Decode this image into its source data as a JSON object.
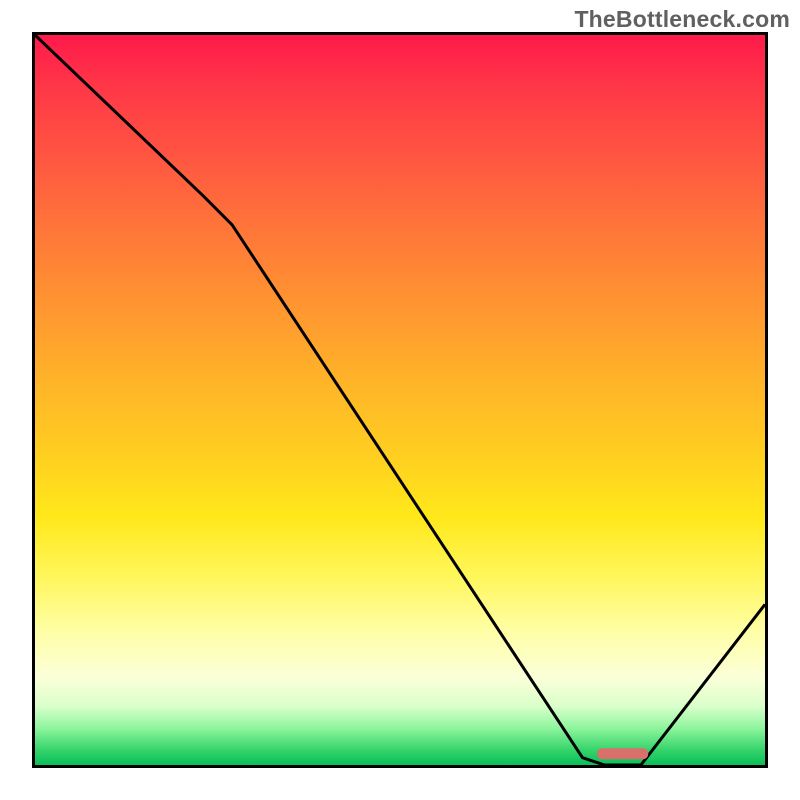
{
  "watermark": "TheBottleneck.com",
  "chart_data": {
    "type": "line",
    "title": "",
    "xlabel": "",
    "ylabel": "",
    "xlim": [
      0,
      100
    ],
    "ylim": [
      0,
      100
    ],
    "grid": false,
    "series": [
      {
        "name": "curve",
        "x": [
          0,
          23,
          27,
          75,
          78,
          83,
          100
        ],
        "y": [
          100,
          78,
          74,
          1,
          0,
          0,
          22
        ],
        "color": "#000000"
      }
    ],
    "marker": {
      "type": "rounded-bar",
      "x_range": [
        77,
        84
      ],
      "y": 0.8,
      "color": "#d9706a"
    },
    "background_gradient_stops": [
      {
        "pos": 0,
        "color": "#ff1a4b"
      },
      {
        "pos": 18,
        "color": "#ff5a40"
      },
      {
        "pos": 38,
        "color": "#ff9830"
      },
      {
        "pos": 58,
        "color": "#ffd020"
      },
      {
        "pos": 74,
        "color": "#fff65a"
      },
      {
        "pos": 88,
        "color": "#fbffd8"
      },
      {
        "pos": 95,
        "color": "#8cf59c"
      },
      {
        "pos": 100,
        "color": "#0abf5a"
      }
    ]
  }
}
